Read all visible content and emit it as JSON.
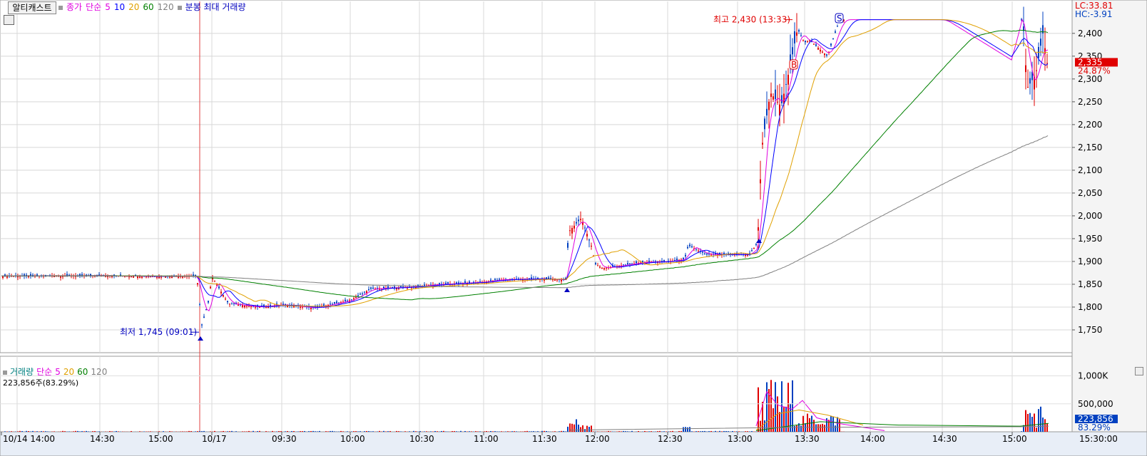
{
  "header": {
    "title_button": "알티캐스트",
    "price_label": "종가",
    "ma_type": "단순",
    "ma_periods": [
      "5",
      "10",
      "20",
      "60",
      "120"
    ],
    "ma_colors": [
      "#e000e0",
      "#0000ff",
      "#e0a000",
      "#008000",
      "#808080"
    ],
    "option_label": "분봉 최대 거래량",
    "lc_label": "LC:33.81",
    "hc_label": "HC:-3.91"
  },
  "price_panel": {
    "y_ticks": [
      "2,400",
      "2,350",
      "2,300",
      "2,250",
      "2,200",
      "2,150",
      "2,100",
      "2,050",
      "2,000",
      "1,950",
      "1,900",
      "1,850",
      "1,800",
      "1,750"
    ],
    "current_price": "2,335",
    "current_change": "24.87%",
    "high_annotation": "최고 2,430 (13:33)",
    "low_annotation": "최저 1,745 (09:01)",
    "buy_marker": "B",
    "sell_marker": "S"
  },
  "volume_panel": {
    "title": "거래량",
    "ma_type": "단순",
    "ma_periods": [
      "5",
      "20",
      "60",
      "120"
    ],
    "ma_colors": [
      "#e000e0",
      "#e0a000",
      "#008000",
      "#808080"
    ],
    "last_volume": "223,856주(83.29%)",
    "y_ticks": [
      "1,000K",
      "500,000"
    ],
    "current_volume": "223,856",
    "current_pct": "83.29%"
  },
  "x_axis": {
    "labels": [
      "10/14 14:00",
      "14:30",
      "15:00",
      "10/17",
      "09:30",
      "10:00",
      "10:30",
      "11:00",
      "11:30",
      "12:00",
      "12:30",
      "13:00",
      "13:30",
      "14:00",
      "14:30",
      "15:00",
      "15:30:00"
    ]
  },
  "chart_data": {
    "type": "candlestick",
    "x_labels": [
      "10/14 14:00",
      "14:30",
      "15:00",
      "10/17",
      "09:30",
      "10:00",
      "10:30",
      "11:00",
      "11:30",
      "12:00",
      "12:30",
      "13:00",
      "13:30",
      "14:00",
      "14:30",
      "15:00"
    ],
    "ylim": [
      1700,
      2470
    ],
    "y_ticks": [
      1750,
      1800,
      1850,
      1900,
      1950,
      2000,
      2050,
      2100,
      2150,
      2200,
      2250,
      2300,
      2350,
      2400
    ],
    "high": 2430,
    "low": 1745,
    "last_close": 2335,
    "close_series_by_label": [
      {
        "x": "10/14 14:00",
        "close": 1868
      },
      {
        "x": "14:30",
        "close": 1869
      },
      {
        "x": "15:00",
        "close": 1867
      },
      {
        "x": "10/17",
        "close": 1867
      },
      {
        "x": "09:30",
        "close": 1805
      },
      {
        "x": "10:00",
        "close": 1815
      },
      {
        "x": "10:30",
        "close": 1845
      },
      {
        "x": "11:00",
        "close": 1855
      },
      {
        "x": "11:30",
        "close": 1862
      },
      {
        "x": "12:00",
        "close": 1895
      },
      {
        "x": "12:30",
        "close": 1900
      },
      {
        "x": "13:00",
        "close": 1915
      },
      {
        "x": "13:30",
        "close": 2380
      },
      {
        "x": "14:00",
        "close": 2430
      },
      {
        "x": "14:30",
        "close": 2430
      },
      {
        "x": "15:00",
        "close": 2335
      }
    ],
    "volume_ylim": [
      0,
      1300000
    ]
  }
}
